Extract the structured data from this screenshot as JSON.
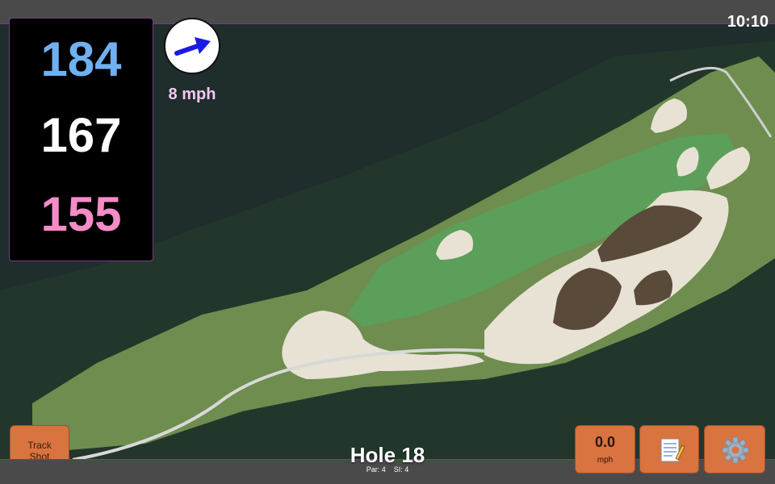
{
  "status": {
    "time": "10:10"
  },
  "distances": {
    "back": "184",
    "middle": "167",
    "front": "155"
  },
  "wind": {
    "speed": "8 mph",
    "icon": "wind-arrow-icon",
    "arrow_color": "#1a1ae6"
  },
  "hole": {
    "title": "Hole 18",
    "par": "Par: 4",
    "stroke_index": "SI: 4"
  },
  "buttons": {
    "track_line1": "Track",
    "track_line2": "Shot",
    "speed_value": "0.0",
    "speed_unit": "mph",
    "notes_icon": "scorecard-notes-icon",
    "settings_icon": "gear-icon"
  },
  "colors": {
    "back_distance": "#6fb0f0",
    "middle_distance": "#ffffff",
    "front_distance": "#f58bc7",
    "button": "#d9733f",
    "accent_border": "#7a3b86"
  }
}
